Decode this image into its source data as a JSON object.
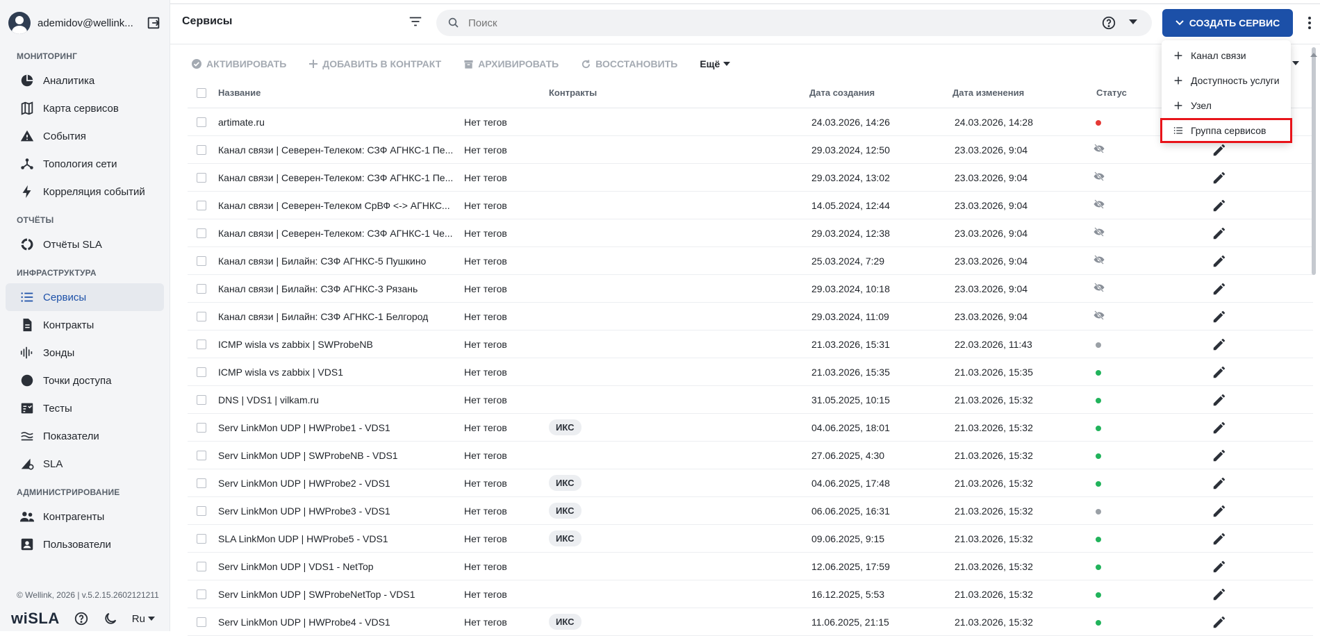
{
  "user": {
    "name": "ademidov@wellink..."
  },
  "sidebar": {
    "sections": [
      {
        "title": "Мониторинг",
        "items": [
          {
            "label": "Аналитика",
            "icon": "pie-chart-icon"
          },
          {
            "label": "Карта сервисов",
            "icon": "map-icon"
          },
          {
            "label": "События",
            "icon": "warning-icon"
          },
          {
            "label": "Топология сети",
            "icon": "topology-icon"
          },
          {
            "label": "Корреляция событий",
            "icon": "bolt-icon"
          }
        ]
      },
      {
        "title": "Отчёты",
        "items": [
          {
            "label": "Отчёты SLA",
            "icon": "donut-icon"
          }
        ]
      },
      {
        "title": "Инфраструктура",
        "items": [
          {
            "label": "Сервисы",
            "icon": "list-icon",
            "active": true
          },
          {
            "label": "Контракты",
            "icon": "document-icon"
          },
          {
            "label": "Зонды",
            "icon": "probe-icon"
          },
          {
            "label": "Точки доступа",
            "icon": "circle-icon"
          },
          {
            "label": "Тесты",
            "icon": "tests-icon"
          },
          {
            "label": "Показатели",
            "icon": "metrics-icon"
          },
          {
            "label": "SLA",
            "icon": "sla-icon"
          }
        ]
      },
      {
        "title": "Администрирование",
        "items": [
          {
            "label": "Контрагенты",
            "icon": "people-icon"
          },
          {
            "label": "Пользователи",
            "icon": "user-card-icon"
          }
        ]
      }
    ],
    "copyright": "© Wellink, 2026 | v.5.2.15.2602121211",
    "logo": "wiSLA",
    "lang": "Ru"
  },
  "header": {
    "title": "Сервисы",
    "search_placeholder": "Поиск",
    "create_label": "СОЗДАТЬ СЕРВИС"
  },
  "toolbar": {
    "activate": "АКТИВИРОВАТЬ",
    "add_contract": "ДОБАВИТЬ В КОНТРАКТ",
    "archive": "АРХИВИРОВАТЬ",
    "restore": "ВОССТАНОВИТЬ",
    "more": "Ещё"
  },
  "table": {
    "columns": {
      "name": "Название",
      "contracts": "Контракты",
      "created": "Дата создания",
      "modified": "Дата изменения",
      "status": "Статус"
    },
    "rows": [
      {
        "name": "artimate.ru",
        "tags": "Нет тегов",
        "contract": "",
        "created": "24.03.2026, 14:26",
        "modified": "24.03.2026, 14:28",
        "status": "red"
      },
      {
        "name": "Канал связи | Северен-Телеком: СЗФ АГНКС-1 Пе...",
        "tags": "Нет тегов",
        "contract": "",
        "created": "29.03.2024, 12:50",
        "modified": "23.03.2026, 9:04",
        "status": "hidden"
      },
      {
        "name": "Канал связи | Северен-Телеком: СЗФ АГНКС-1 Пе...",
        "tags": "Нет тегов",
        "contract": "",
        "created": "29.03.2024, 13:02",
        "modified": "23.03.2026, 9:04",
        "status": "hidden"
      },
      {
        "name": "Канал связи | Северен-Телеком СрВФ <-> АГНКС...",
        "tags": "Нет тегов",
        "contract": "",
        "created": "14.05.2024, 12:44",
        "modified": "23.03.2026, 9:04",
        "status": "hidden"
      },
      {
        "name": "Канал связи | Северен-Телеком: СЗФ АГНКС-1 Че...",
        "tags": "Нет тегов",
        "contract": "",
        "created": "29.03.2024, 12:38",
        "modified": "23.03.2026, 9:04",
        "status": "hidden"
      },
      {
        "name": "Канал связи | Билайн: СЗФ АГНКС-5 Пушкино",
        "tags": "Нет тегов",
        "contract": "",
        "created": "25.03.2024, 7:29",
        "modified": "23.03.2026, 9:04",
        "status": "hidden"
      },
      {
        "name": "Канал связи | Билайн: СЗФ АГНКС-3 Рязань",
        "tags": "Нет тегов",
        "contract": "",
        "created": "29.03.2024, 10:18",
        "modified": "23.03.2026, 9:04",
        "status": "hidden"
      },
      {
        "name": "Канал связи | Билайн: СЗФ АГНКС-1 Белгород",
        "tags": "Нет тегов",
        "contract": "",
        "created": "29.03.2024, 11:09",
        "modified": "23.03.2026, 9:04",
        "status": "hidden"
      },
      {
        "name": "ICMP wisla vs zabbix | SWProbeNB",
        "tags": "Нет тегов",
        "contract": "",
        "created": "21.03.2026, 15:31",
        "modified": "22.03.2026, 11:43",
        "status": "grey"
      },
      {
        "name": "ICMP wisla vs zabbix | VDS1",
        "tags": "Нет тегов",
        "contract": "",
        "created": "21.03.2026, 15:35",
        "modified": "21.03.2026, 15:35",
        "status": "green"
      },
      {
        "name": "DNS | VDS1 | vilkam.ru",
        "tags": "Нет тегов",
        "contract": "",
        "created": "31.05.2025, 10:15",
        "modified": "21.03.2026, 15:32",
        "status": "green"
      },
      {
        "name": "Serv LinkMon UDP | HWProbe1 - VDS1",
        "tags": "Нет тегов",
        "contract": "ИКС",
        "created": "04.06.2025, 18:01",
        "modified": "21.03.2026, 15:32",
        "status": "green"
      },
      {
        "name": "Serv LinkMon UDP | SWProbeNB - VDS1",
        "tags": "Нет тегов",
        "contract": "",
        "created": "27.06.2025, 4:30",
        "modified": "21.03.2026, 15:32",
        "status": "green"
      },
      {
        "name": "Serv LinkMon UDP | HWProbe2 - VDS1",
        "tags": "Нет тегов",
        "contract": "ИКС",
        "created": "04.06.2025, 17:48",
        "modified": "21.03.2026, 15:32",
        "status": "green"
      },
      {
        "name": "Serv LinkMon UDP | HWProbe3 - VDS1",
        "tags": "Нет тегов",
        "contract": "ИКС",
        "created": "06.06.2025, 16:31",
        "modified": "21.03.2026, 15:32",
        "status": "grey"
      },
      {
        "name": "SLA LinkMon UDP | HWProbe5 - VDS1",
        "tags": "Нет тегов",
        "contract": "ИКС",
        "created": "09.06.2025, 9:15",
        "modified": "21.03.2026, 15:32",
        "status": "green"
      },
      {
        "name": "Serv LinkMon UDP | VDS1 - NetTop",
        "tags": "Нет тегов",
        "contract": "",
        "created": "12.06.2025, 17:59",
        "modified": "21.03.2026, 15:32",
        "status": "green"
      },
      {
        "name": "Serv LinkMon UDP | SWProbeNetTop - VDS1",
        "tags": "Нет тегов",
        "contract": "",
        "created": "16.12.2025, 5:53",
        "modified": "21.03.2026, 15:32",
        "status": "green"
      },
      {
        "name": "Serv LinkMon UDP | HWProbe4 - VDS1",
        "tags": "Нет тегов",
        "contract": "ИКС",
        "created": "11.06.2025, 21:15",
        "modified": "21.03.2026, 15:32",
        "status": "green"
      }
    ]
  },
  "dropdown_menu": {
    "items": [
      {
        "label": "Канал связи",
        "icon": "plus-icon"
      },
      {
        "label": "Доступность услуги",
        "icon": "plus-icon"
      },
      {
        "label": "Узел",
        "icon": "plus-icon"
      },
      {
        "label": "Группа сервисов",
        "icon": "list-icon",
        "highlighted": true
      }
    ]
  },
  "colors": {
    "accent": "#1c50a8",
    "status_red": "#e53935",
    "status_green": "#21b35b",
    "status_grey": "#9aa0a6",
    "highlight": "#e8141a"
  }
}
